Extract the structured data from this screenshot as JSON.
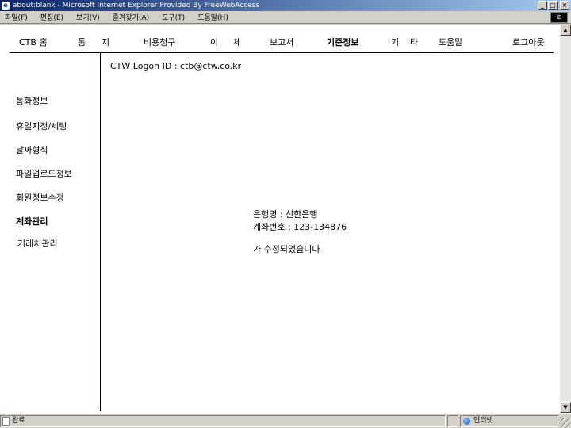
{
  "window": {
    "title": "about:blank - Microsoft Internet Explorer Provided By FreeWebAccess",
    "minimize": "_",
    "maximize": "□",
    "close": "×"
  },
  "menubar": {
    "items": [
      "파일(F)",
      "편집(E)",
      "보기(V)",
      "즐겨찾기(A)",
      "도구(T)",
      "도움말(H)"
    ]
  },
  "topnav": {
    "items": [
      {
        "label": "CTB 홈"
      },
      {
        "label": "통"
      },
      {
        "label": "지"
      },
      {
        "label": "비용청구"
      },
      {
        "label": "이"
      },
      {
        "label": "체"
      },
      {
        "label": "보고서"
      },
      {
        "label": "기준정보"
      },
      {
        "label": "기"
      },
      {
        "label": "타"
      },
      {
        "label": "도움말"
      },
      {
        "label": "로그아웃"
      }
    ]
  },
  "sidebar": {
    "items": [
      {
        "label": "통화정보"
      },
      {
        "label": "휴일지정/세팅"
      },
      {
        "label": "날짜형식"
      },
      {
        "label": "파일업로드정보"
      },
      {
        "label": "회원정보수정"
      },
      {
        "label": "계좌관리"
      },
      {
        "label": "거래처관리"
      }
    ]
  },
  "main": {
    "logon_label": "CTW Logon ID : ctb@ctw.co.kr",
    "bank_name": "은행명 : 신한은행",
    "account_number": "계좌번호 : 123-134876",
    "message": "가 수정되었습니다"
  },
  "status": {
    "text": "완료",
    "zone": "인터넷"
  }
}
